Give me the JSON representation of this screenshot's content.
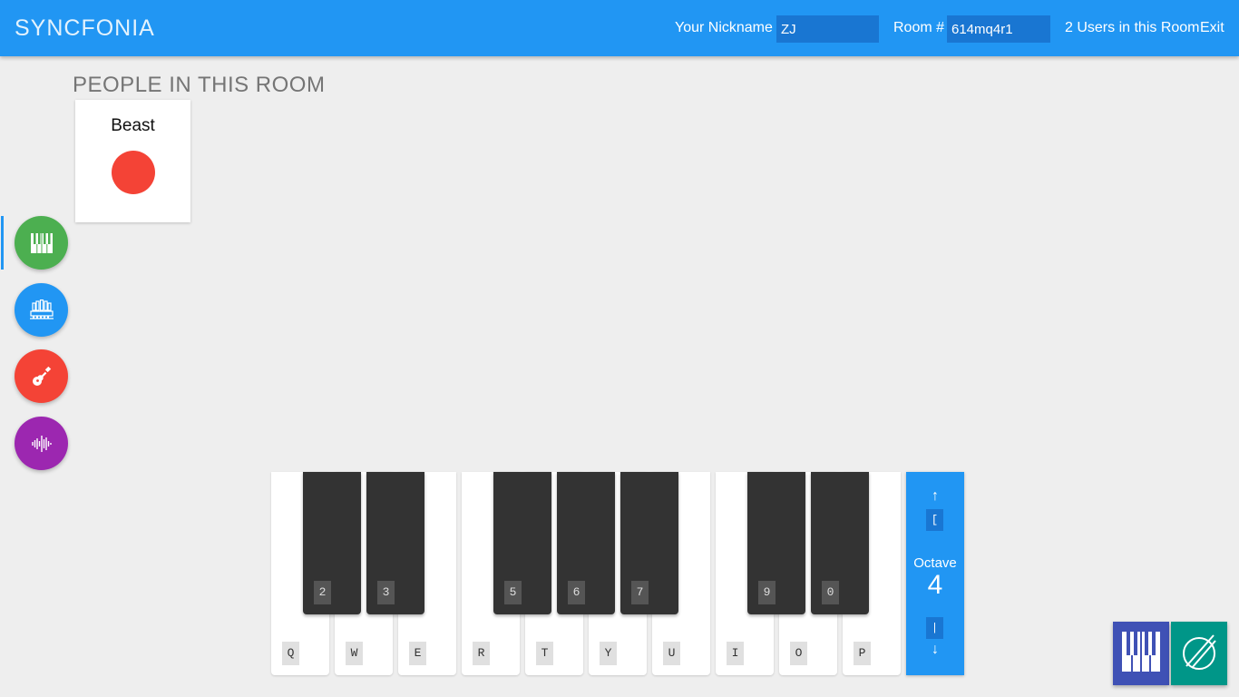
{
  "header": {
    "brand": "SYNCFONIA",
    "nickname_label": "Your Nickname",
    "nickname_value": "ZJ",
    "room_label": "Room #",
    "room_value": "614mq4r1",
    "users_count": "2 Users in this Room",
    "exit_label": "Exit"
  },
  "people": {
    "heading": "PEOPLE IN THIS ROOM",
    "members": [
      {
        "name": "Beast",
        "color": "#f44336"
      }
    ]
  },
  "instruments": [
    {
      "name": "piano-icon",
      "color": "#4caf50",
      "active": true
    },
    {
      "name": "organ-icon",
      "color": "#2196f3",
      "active": false
    },
    {
      "name": "guitar-icon",
      "color": "#f44336",
      "active": false
    },
    {
      "name": "waveform-icon",
      "color": "#9c27b0",
      "active": false
    }
  ],
  "keyboard": {
    "white_keys": [
      "Q",
      "W",
      "E",
      "R",
      "T",
      "Y",
      "U",
      "I",
      "O",
      "P"
    ],
    "black_keys": [
      "2",
      "3",
      "5",
      "6",
      "7",
      "9",
      "0"
    ]
  },
  "octave": {
    "up_arrow": "↑",
    "up_key": "[",
    "label": "Octave",
    "value": "4",
    "down_key": "|",
    "down_arrow": "↓"
  },
  "corner_buttons": [
    {
      "name": "piano-keyboard-icon",
      "color": "#3f51b5"
    },
    {
      "name": "drum-icon",
      "color": "#009688"
    }
  ]
}
